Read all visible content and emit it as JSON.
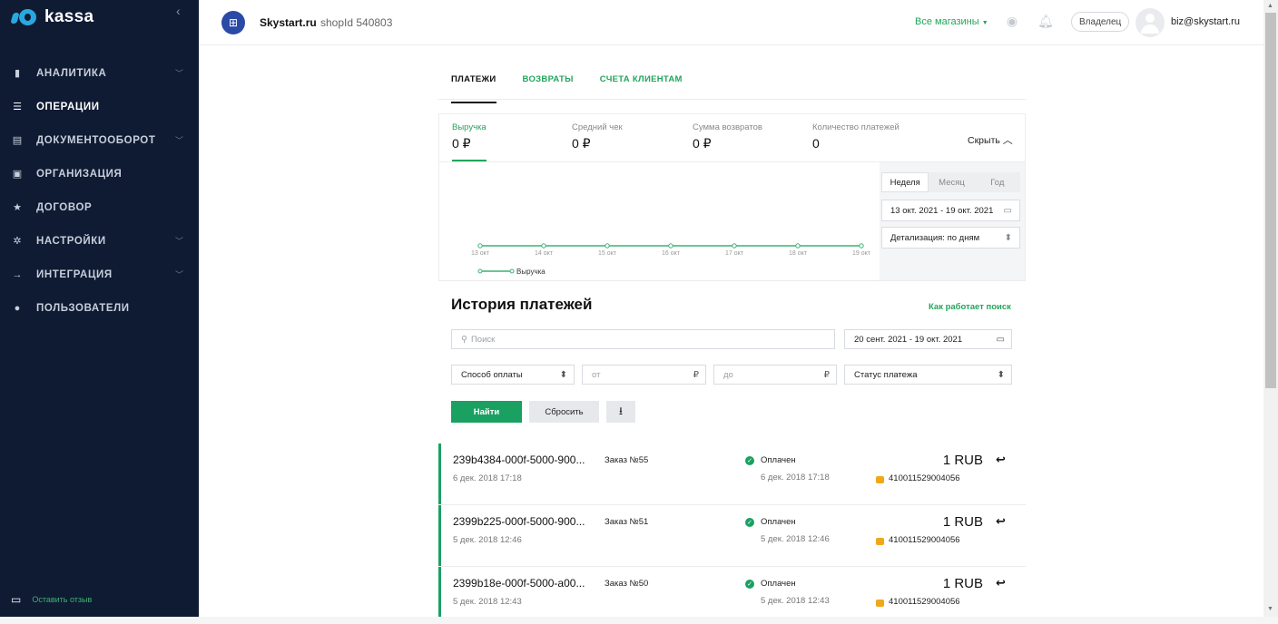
{
  "brand": {
    "name": "kassa",
    "accent": "#22a55b"
  },
  "sidebar": {
    "items": [
      {
        "label": "АНАЛИТИКА",
        "icon": "bar-chart-icon",
        "expandable": true
      },
      {
        "label": "ОПЕРАЦИИ",
        "icon": "list-icon",
        "expandable": false,
        "active": true
      },
      {
        "label": "ДОКУМЕНТООБОРОТ",
        "icon": "document-icon",
        "expandable": true
      },
      {
        "label": "ОРГАНИЗАЦИЯ",
        "icon": "organization-icon",
        "expandable": false
      },
      {
        "label": "ДОГОВОР",
        "icon": "star-icon",
        "expandable": false
      },
      {
        "label": "НАСТРОЙКИ",
        "icon": "gear-icon",
        "expandable": true
      },
      {
        "label": "ИНТЕГРАЦИЯ",
        "icon": "arrow-right-icon",
        "expandable": true
      },
      {
        "label": "ПОЛЬЗОВАТЕЛИ",
        "icon": "user-icon",
        "expandable": false
      }
    ],
    "feedback_label": "Оставить отзыв"
  },
  "header": {
    "shop_name": "Skystart.ru",
    "shop_id": "shopId 540803",
    "all_shops": "Все магазины",
    "role": "Владелец",
    "user_email": "biz@skystart.ru"
  },
  "tabs": [
    {
      "label": "ПЛАТЕЖИ",
      "active": true
    },
    {
      "label": "ВОЗВРАТЫ"
    },
    {
      "label": "СЧЕТА КЛИЕНТАМ"
    }
  ],
  "stats": {
    "items": [
      {
        "caption": "Выручка",
        "value": "0 ₽"
      },
      {
        "caption": "Средний чек",
        "value": "0 ₽"
      },
      {
        "caption": "Сумма возвратов",
        "value": "0 ₽"
      },
      {
        "caption": "Количество платежей",
        "value": "0"
      }
    ],
    "hide_label": "Скрыть",
    "periods": [
      "Неделя",
      "Месяц",
      "Год"
    ],
    "selected_period": "Неделя",
    "date_range": "13 окт. 2021 - 19 окт. 2021",
    "detail": "Детализация: по дням"
  },
  "chart_data": {
    "type": "line",
    "categories": [
      "13 окт",
      "14 окт",
      "15 окт",
      "16 окт",
      "17 окт",
      "18 окт",
      "19 окт"
    ],
    "series": [
      {
        "name": "Выручка",
        "values": [
          0,
          0,
          0,
          0,
          0,
          0,
          0
        ],
        "color": "#3cb371"
      }
    ],
    "legend": "bottom-left"
  },
  "history": {
    "title": "История платежей",
    "how_link": "Как работает поиск",
    "search_placeholder": "Поиск",
    "date_range": "20 сент. 2021 - 19 окт. 2021",
    "payment_method": "Способ оплаты",
    "from_placeholder": "от",
    "to_placeholder": "до",
    "currency": "₽",
    "status": "Статус платежа",
    "find": "Найти",
    "reset": "Сбросить"
  },
  "payments": [
    {
      "id": "239b4384-000f-5000-900...",
      "date": "6 дек. 2018 17:18",
      "order": "Заказ №55",
      "status": "Оплачен",
      "status_date": "6 дек. 2018 17:18",
      "amount": "1 RUB",
      "card": "410011529004056"
    },
    {
      "id": "2399b225-000f-5000-900...",
      "date": "5 дек. 2018 12:46",
      "order": "Заказ №51",
      "status": "Оплачен",
      "status_date": "5 дек. 2018 12:46",
      "amount": "1 RUB",
      "card": "410011529004056"
    },
    {
      "id": "2399b18e-000f-5000-a00...",
      "date": "5 дек. 2018 12:43",
      "order": "Заказ №50",
      "status": "Оплачен",
      "status_date": "5 дек. 2018 12:43",
      "amount": "1 RUB",
      "card": "410011529004056"
    }
  ]
}
